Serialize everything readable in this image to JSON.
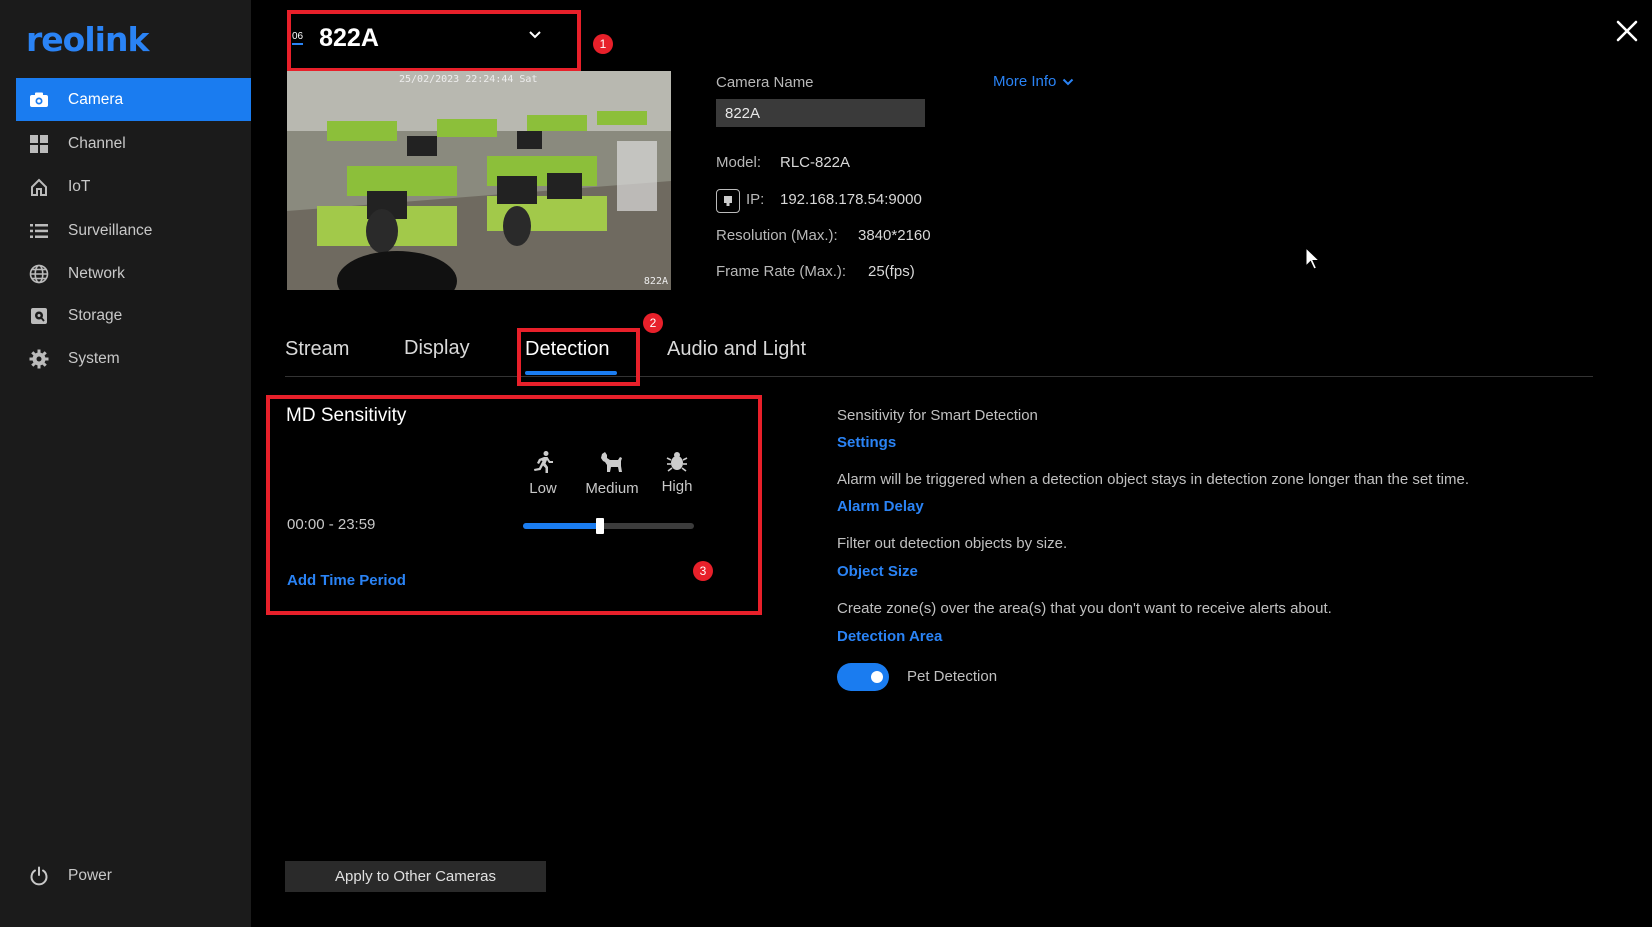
{
  "brand": {
    "logo": "reolink",
    "accent": "#1a7cf0",
    "highlight": "#e8202a"
  },
  "sidebar": {
    "items": [
      {
        "label": "Camera",
        "icon": "camera-icon",
        "active": true
      },
      {
        "label": "Channel",
        "icon": "grid-icon"
      },
      {
        "label": "IoT",
        "icon": "home-icon"
      },
      {
        "label": "Surveillance",
        "icon": "list-icon"
      },
      {
        "label": "Network",
        "icon": "globe-icon"
      },
      {
        "label": "Storage",
        "icon": "storage-icon"
      },
      {
        "label": "System",
        "icon": "gear-icon"
      }
    ],
    "power_label": "Power"
  },
  "camera_select": {
    "channel": "06",
    "name": "822A"
  },
  "annotations": {
    "badge1": "1",
    "badge2": "2",
    "badge3": "3"
  },
  "preview": {
    "osd_time": "25/02/2023 22:24:44 Sat",
    "osd_name": "822A"
  },
  "info": {
    "camera_name_label": "Camera Name",
    "camera_name_value": "822A",
    "more_info": "More Info",
    "model_label": "Model:",
    "model_value": "RLC-822A",
    "ip_label": "IP:",
    "ip_value": "192.168.178.54:9000",
    "resolution_label": "Resolution (Max.):",
    "resolution_value": "3840*2160",
    "framerate_label": "Frame Rate (Max.):",
    "framerate_value": "25(fps)"
  },
  "tabs": [
    {
      "label": "Stream"
    },
    {
      "label": "Display"
    },
    {
      "label": "Detection",
      "active": true
    },
    {
      "label": "Audio and Light"
    }
  ],
  "md": {
    "title": "MD Sensitivity",
    "levels": [
      {
        "label": "Low",
        "icon": "running-person-icon"
      },
      {
        "label": "Medium",
        "icon": "dog-icon"
      },
      {
        "label": "High",
        "icon": "bug-icon"
      }
    ],
    "period": "00:00 - 23:59",
    "sensitivity_fraction": 0.45,
    "add_period": "Add Time Period"
  },
  "right": {
    "smart_text": "Sensitivity for Smart Detection",
    "settings_link": "Settings",
    "alarm_text": "Alarm will be triggered when a detection object stays in detection zone longer than the set time.",
    "alarm_link": "Alarm Delay",
    "size_text": "Filter out detection objects by size.",
    "size_link": "Object Size",
    "zone_text": "Create zone(s) over the area(s) that you don't want to receive alerts about.",
    "zone_link": "Detection Area",
    "pet_label": "Pet Detection",
    "pet_enabled": true
  },
  "apply_button": "Apply to Other Cameras"
}
